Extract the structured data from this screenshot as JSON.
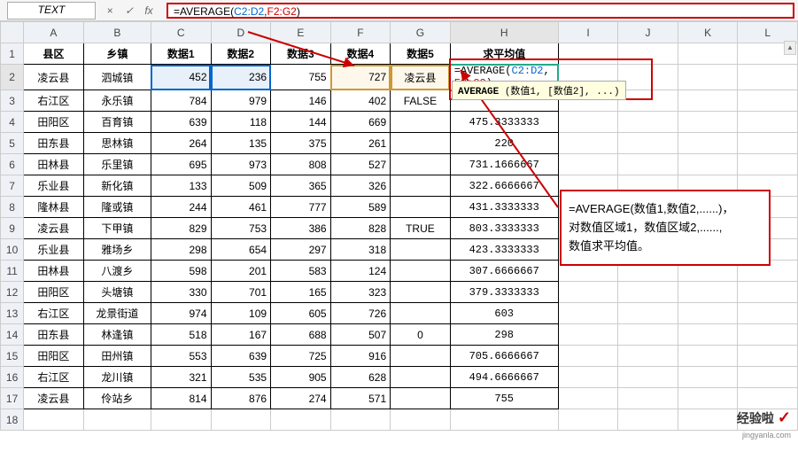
{
  "formula_bar": {
    "name_box": "TEXT",
    "cancel_icon": "×",
    "confirm_icon": "✓",
    "fx_icon": "fx",
    "formula_text_pre": "=AVERAGE(",
    "ref1": "C2:D2",
    "sep": ",",
    "ref2": "F2:G2",
    "formula_text_post": ")"
  },
  "column_headers": [
    "",
    "A",
    "B",
    "C",
    "D",
    "E",
    "F",
    "G",
    "H",
    "I",
    "J",
    "K",
    "L"
  ],
  "header_row": [
    "县区",
    "乡镇",
    "数据1",
    "数据2",
    "数据3",
    "数据4",
    "数据5",
    "求平均值"
  ],
  "rows": [
    {
      "n": "2",
      "a": "凌云县",
      "b": "泗城镇",
      "c": "452",
      "d": "236",
      "e": "755",
      "f": "727",
      "g": "凌云县",
      "h_formula": true
    },
    {
      "n": "3",
      "a": "右江区",
      "b": "永乐镇",
      "c": "784",
      "d": "979",
      "e": "146",
      "f": "402",
      "g": "FALSE",
      "h": ""
    },
    {
      "n": "4",
      "a": "田阳区",
      "b": "百育镇",
      "c": "639",
      "d": "118",
      "e": "144",
      "f": "669",
      "g": "",
      "h": "475.3333333"
    },
    {
      "n": "5",
      "a": "田东县",
      "b": "思林镇",
      "c": "264",
      "d": "135",
      "e": "375",
      "f": "261",
      "g": "",
      "h": "220"
    },
    {
      "n": "6",
      "a": "田林县",
      "b": "乐里镇",
      "c": "695",
      "d": "973",
      "e": "808",
      "f": "527",
      "g": "",
      "h": "731.1666667"
    },
    {
      "n": "7",
      "a": "乐业县",
      "b": "新化镇",
      "c": "133",
      "d": "509",
      "e": "365",
      "f": "326",
      "g": "",
      "h": "322.6666667"
    },
    {
      "n": "8",
      "a": "隆林县",
      "b": "隆或镇",
      "c": "244",
      "d": "461",
      "e": "777",
      "f": "589",
      "g": "",
      "h": "431.3333333"
    },
    {
      "n": "9",
      "a": "凌云县",
      "b": "下甲镇",
      "c": "829",
      "d": "753",
      "e": "386",
      "f": "828",
      "g": "TRUE",
      "h": "803.3333333"
    },
    {
      "n": "10",
      "a": "乐业县",
      "b": "雅场乡",
      "c": "298",
      "d": "654",
      "e": "297",
      "f": "318",
      "g": "",
      "h": "423.3333333"
    },
    {
      "n": "11",
      "a": "田林县",
      "b": "八渡乡",
      "c": "598",
      "d": "201",
      "e": "583",
      "f": "124",
      "g": "",
      "h": "307.6666667"
    },
    {
      "n": "12",
      "a": "田阳区",
      "b": "头塘镇",
      "c": "330",
      "d": "701",
      "e": "165",
      "f": "323",
      "g": "",
      "h": "379.3333333"
    },
    {
      "n": "13",
      "a": "右江区",
      "b": "龙景街道",
      "c": "974",
      "d": "109",
      "e": "605",
      "f": "726",
      "g": "",
      "h": "603"
    },
    {
      "n": "14",
      "a": "田东县",
      "b": "林逢镇",
      "c": "518",
      "d": "167",
      "e": "688",
      "f": "507",
      "g": "0",
      "h": "298"
    },
    {
      "n": "15",
      "a": "田阳区",
      "b": "田州镇",
      "c": "553",
      "d": "639",
      "e": "725",
      "f": "916",
      "g": "",
      "h": "705.6666667"
    },
    {
      "n": "16",
      "a": "右江区",
      "b": "龙川镇",
      "c": "321",
      "d": "535",
      "e": "905",
      "f": "628",
      "g": "",
      "h": "494.6666667"
    },
    {
      "n": "17",
      "a": "凌云县",
      "b": "伶站乡",
      "c": "814",
      "d": "876",
      "e": "274",
      "f": "571",
      "g": "",
      "h": "755"
    },
    {
      "n": "18",
      "a": "",
      "b": "",
      "c": "",
      "d": "",
      "e": "",
      "f": "",
      "g": "",
      "h": "",
      "blank": true
    }
  ],
  "active_cell_formula": {
    "pre": "=AVERAGE(",
    "ref1": "C2:D2",
    "sep": ", ",
    "ref2": "F2:G2",
    "post": ")"
  },
  "tooltip": {
    "fn": "AVERAGE",
    "args": " (数值1, [数值2], ...)"
  },
  "callout": {
    "line1": "=AVERAGE(数值1,数值2,......)，",
    "line2": "对数值区域1，数值区域2,......,",
    "line3": "数值求平均值。"
  },
  "watermark": {
    "text": "经验啦",
    "check": "✓",
    "sub": "jingyanla.com"
  },
  "chart_data": {
    "type": "table",
    "title": "求平均值",
    "columns": [
      "县区",
      "乡镇",
      "数据1",
      "数据2",
      "数据3",
      "数据4",
      "数据5",
      "求平均值"
    ],
    "rows": [
      [
        "凌云县",
        "泗城镇",
        452,
        236,
        755,
        727,
        "凌云县",
        "=AVERAGE(C2:D2, F2:G2)"
      ],
      [
        "右江区",
        "永乐镇",
        784,
        979,
        146,
        402,
        "FALSE",
        null
      ],
      [
        "田阳区",
        "百育镇",
        639,
        118,
        144,
        669,
        null,
        475.3333333
      ],
      [
        "田东县",
        "思林镇",
        264,
        135,
        375,
        261,
        null,
        220
      ],
      [
        "田林县",
        "乐里镇",
        695,
        973,
        808,
        527,
        null,
        731.1666667
      ],
      [
        "乐业县",
        "新化镇",
        133,
        509,
        365,
        326,
        null,
        322.6666667
      ],
      [
        "隆林县",
        "隆或镇",
        244,
        461,
        777,
        589,
        null,
        431.3333333
      ],
      [
        "凌云县",
        "下甲镇",
        829,
        753,
        386,
        828,
        "TRUE",
        803.3333333
      ],
      [
        "乐业县",
        "雅场乡",
        298,
        654,
        297,
        318,
        null,
        423.3333333
      ],
      [
        "田林县",
        "八渡乡",
        598,
        201,
        583,
        124,
        null,
        307.6666667
      ],
      [
        "田阳区",
        "头塘镇",
        330,
        701,
        165,
        323,
        null,
        379.3333333
      ],
      [
        "右江区",
        "龙景街道",
        974,
        109,
        605,
        726,
        null,
        603
      ],
      [
        "田东县",
        "林逢镇",
        518,
        167,
        688,
        507,
        0,
        298
      ],
      [
        "田阳区",
        "田州镇",
        553,
        639,
        725,
        916,
        null,
        705.6666667
      ],
      [
        "右江区",
        "龙川镇",
        321,
        535,
        905,
        628,
        null,
        494.6666667
      ],
      [
        "凌云县",
        "伶站乡",
        814,
        876,
        274,
        571,
        null,
        755
      ]
    ]
  }
}
